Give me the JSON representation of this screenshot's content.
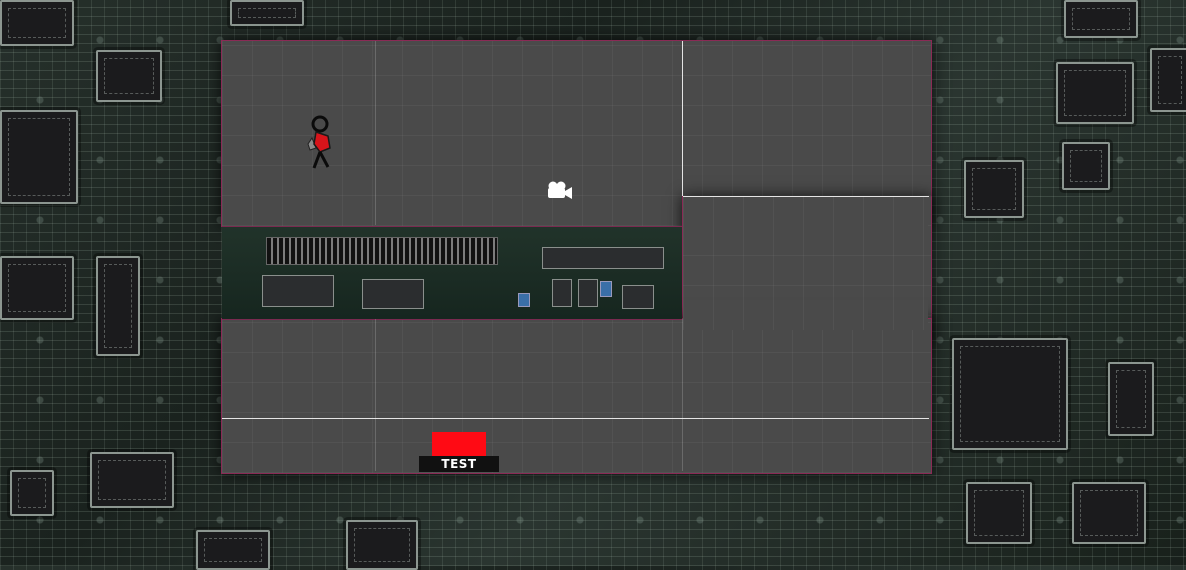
{
  "scene": {
    "background": "circuit-board",
    "room_color": "#4a4a4a",
    "room_border_color": "#8a2a55"
  },
  "player": {
    "sprite": "stick-figure-with-red-shirt",
    "shirt_color": "#d8141a"
  },
  "camera_marker": {
    "icon": "video-camera-icon"
  },
  "test_block": {
    "label": "TEST",
    "color": "#ff0a14"
  }
}
